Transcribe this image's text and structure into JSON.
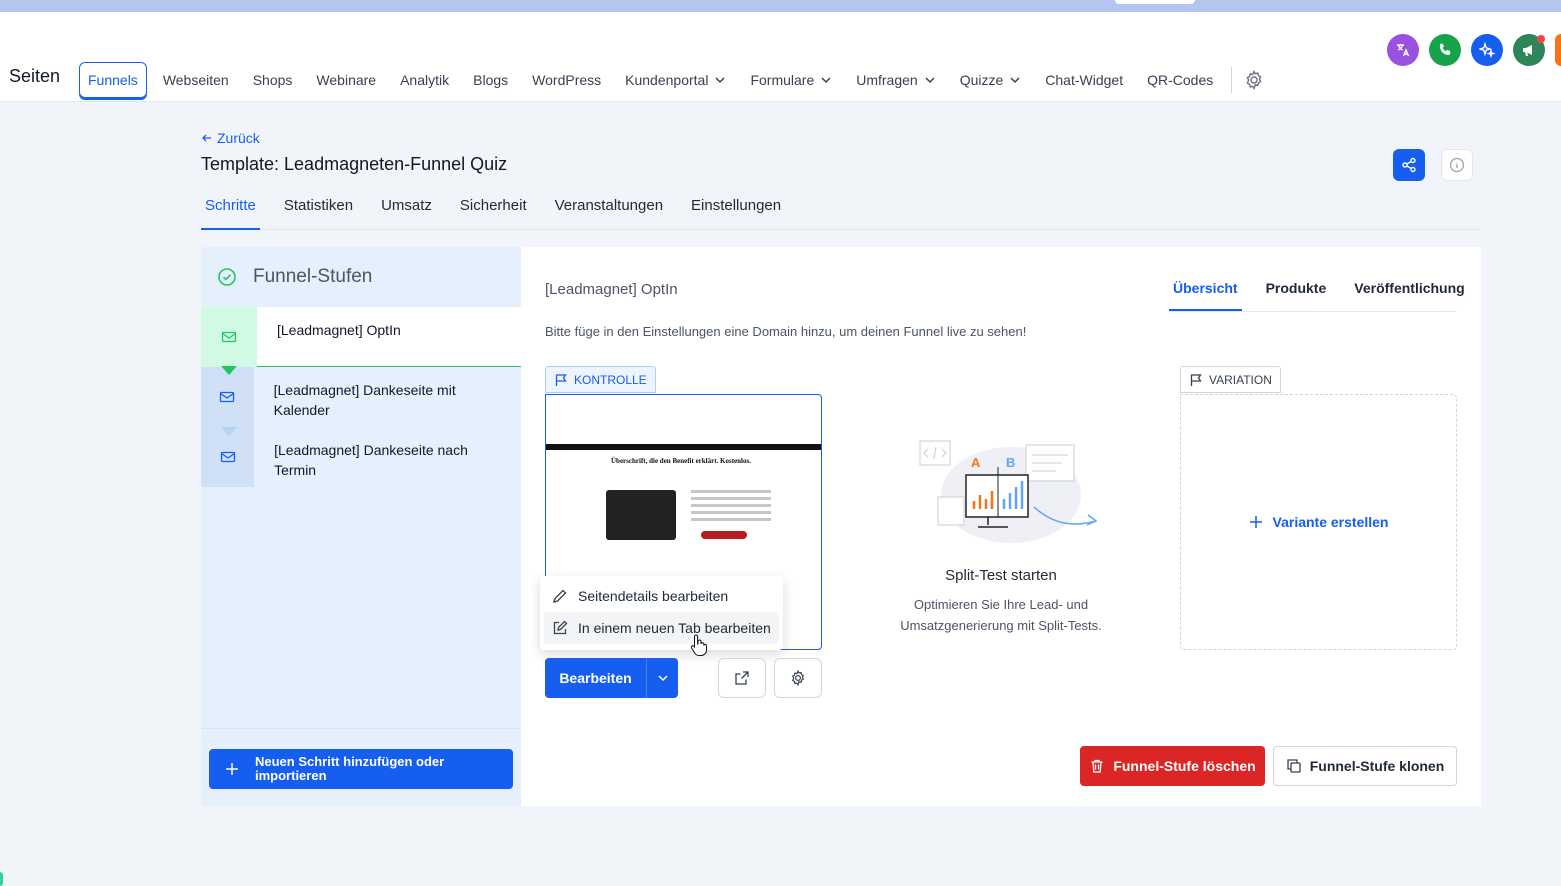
{
  "header": {
    "brand": "Seiten",
    "nav": [
      {
        "label": "Funnels",
        "active": true,
        "dropdown": false
      },
      {
        "label": "Webseiten",
        "dropdown": false
      },
      {
        "label": "Shops",
        "dropdown": false
      },
      {
        "label": "Webinare",
        "dropdown": false
      },
      {
        "label": "Analytik",
        "dropdown": false
      },
      {
        "label": "Blogs",
        "dropdown": false
      },
      {
        "label": "WordPress",
        "dropdown": false
      },
      {
        "label": "Kundenportal",
        "dropdown": true
      },
      {
        "label": "Formulare",
        "dropdown": true
      },
      {
        "label": "Umfragen",
        "dropdown": true
      },
      {
        "label": "Quizze",
        "dropdown": true
      },
      {
        "label": "Chat-Widget",
        "dropdown": false
      },
      {
        "label": "QR-Codes",
        "dropdown": false
      }
    ],
    "round_icons": [
      {
        "name": "translate-icon",
        "color": "#9b51e0"
      },
      {
        "name": "phone-icon",
        "color": "#16a34a"
      },
      {
        "name": "sparkle-icon",
        "color": "#155eef"
      },
      {
        "name": "megaphone-icon",
        "color": "#2f855a"
      },
      {
        "name": "avatar-partial",
        "color": "#f97316"
      }
    ]
  },
  "page": {
    "back_label": "Zurück",
    "title": "Template: Leadmagneten-Funnel Quiz",
    "tabs": [
      "Schritte",
      "Statistiken",
      "Umsatz",
      "Sicherheit",
      "Veranstaltungen",
      "Einstellungen"
    ],
    "active_tab": "Schritte"
  },
  "left_panel": {
    "title": "Funnel-Stufen",
    "steps": [
      {
        "label": "[Leadmagnet] OptIn"
      },
      {
        "label": "[Leadmagnet] Dankeseite mit Kalender"
      },
      {
        "label": "[Leadmagnet] Dankeseite nach Termin"
      }
    ],
    "add_button": "Neuen Schritt hinzufügen oder importieren"
  },
  "right_panel": {
    "step_title": "[Leadmagnet] OptIn",
    "tabs": [
      "Übersicht",
      "Produkte",
      "Veröffentlichung"
    ],
    "domain_hint": "Bitte füge in den Einstellungen eine Domain hinzu, um deinen Funnel live zu sehen!",
    "control_badge": "KONTROLLE",
    "variation_badge": "VARIATION",
    "preview_headline": "Überschrift, die den Benefit erklärt. Kostenlos.",
    "menu": [
      "Seitendetails bearbeiten",
      "In einem neuen Tab bearbeiten"
    ],
    "edit_button": "Bearbeiten",
    "split_title": "Split-Test starten",
    "split_desc": "Optimieren Sie Ihre Lead- und Umsatzgenerierung mit Split-Tests.",
    "illus_a": "A",
    "illus_b": "B",
    "create_variant": "Variante erstellen",
    "delete_button": "Funnel-Stufe löschen",
    "clone_button": "Funnel-Stufe klonen"
  },
  "colors": {
    "primary": "#155eef",
    "success": "#22c55e",
    "danger": "#dc2626",
    "left_panel_bg": "#e6f0fc"
  }
}
